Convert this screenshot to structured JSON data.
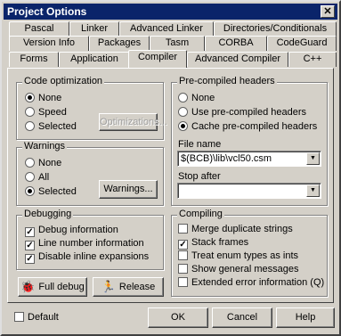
{
  "window": {
    "title": "Project Options",
    "close_glyph": "✕"
  },
  "tabs": {
    "row1": [
      "Pascal",
      "Linker",
      "Advanced Linker",
      "Directories/Conditionals"
    ],
    "row2": [
      "Version Info",
      "Packages",
      "Tasm",
      "CORBA",
      "CodeGuard"
    ],
    "row3": [
      "Forms",
      "Application",
      "Compiler",
      "Advanced Compiler",
      "C++"
    ],
    "active": "Compiler"
  },
  "code_optimization": {
    "title": "Code optimization",
    "options": [
      "None",
      "Speed",
      "Selected"
    ],
    "selected": "None",
    "optimizations_button": "Optimizations..."
  },
  "warnings": {
    "title": "Warnings",
    "options": [
      "None",
      "All",
      "Selected"
    ],
    "selected": "Selected",
    "warnings_button": "Warnings..."
  },
  "debugging": {
    "title": "Debugging",
    "items": [
      "Debug information",
      "Line number information",
      "Disable inline expansions"
    ],
    "checked": [
      true,
      true,
      true
    ]
  },
  "precompiled_headers": {
    "title": "Pre-compiled headers",
    "options": [
      "None",
      "Use pre-compiled headers",
      "Cache pre-compiled headers"
    ],
    "selected": "Cache pre-compiled headers",
    "file_name_label": "File name",
    "file_name_value": "$(BCB)\\lib\\vcl50.csm",
    "stop_after_label": "Stop after",
    "stop_after_value": ""
  },
  "compiling": {
    "title": "Compiling",
    "items": [
      "Merge duplicate strings",
      "Stack frames",
      "Treat enum types as ints",
      "Show general messages",
      "Extended error information (Q)"
    ],
    "checked": [
      false,
      true,
      false,
      false,
      false
    ]
  },
  "buttons": {
    "full_debug": "Full debug",
    "release": "Release",
    "default_label": "Default",
    "ok": "OK",
    "cancel": "Cancel",
    "help": "Help"
  },
  "icons": {
    "full_debug": "bug-icon",
    "release": "runner-icon"
  },
  "colors": {
    "title_bar": "#0a246a",
    "face": "#d4d0c8"
  }
}
